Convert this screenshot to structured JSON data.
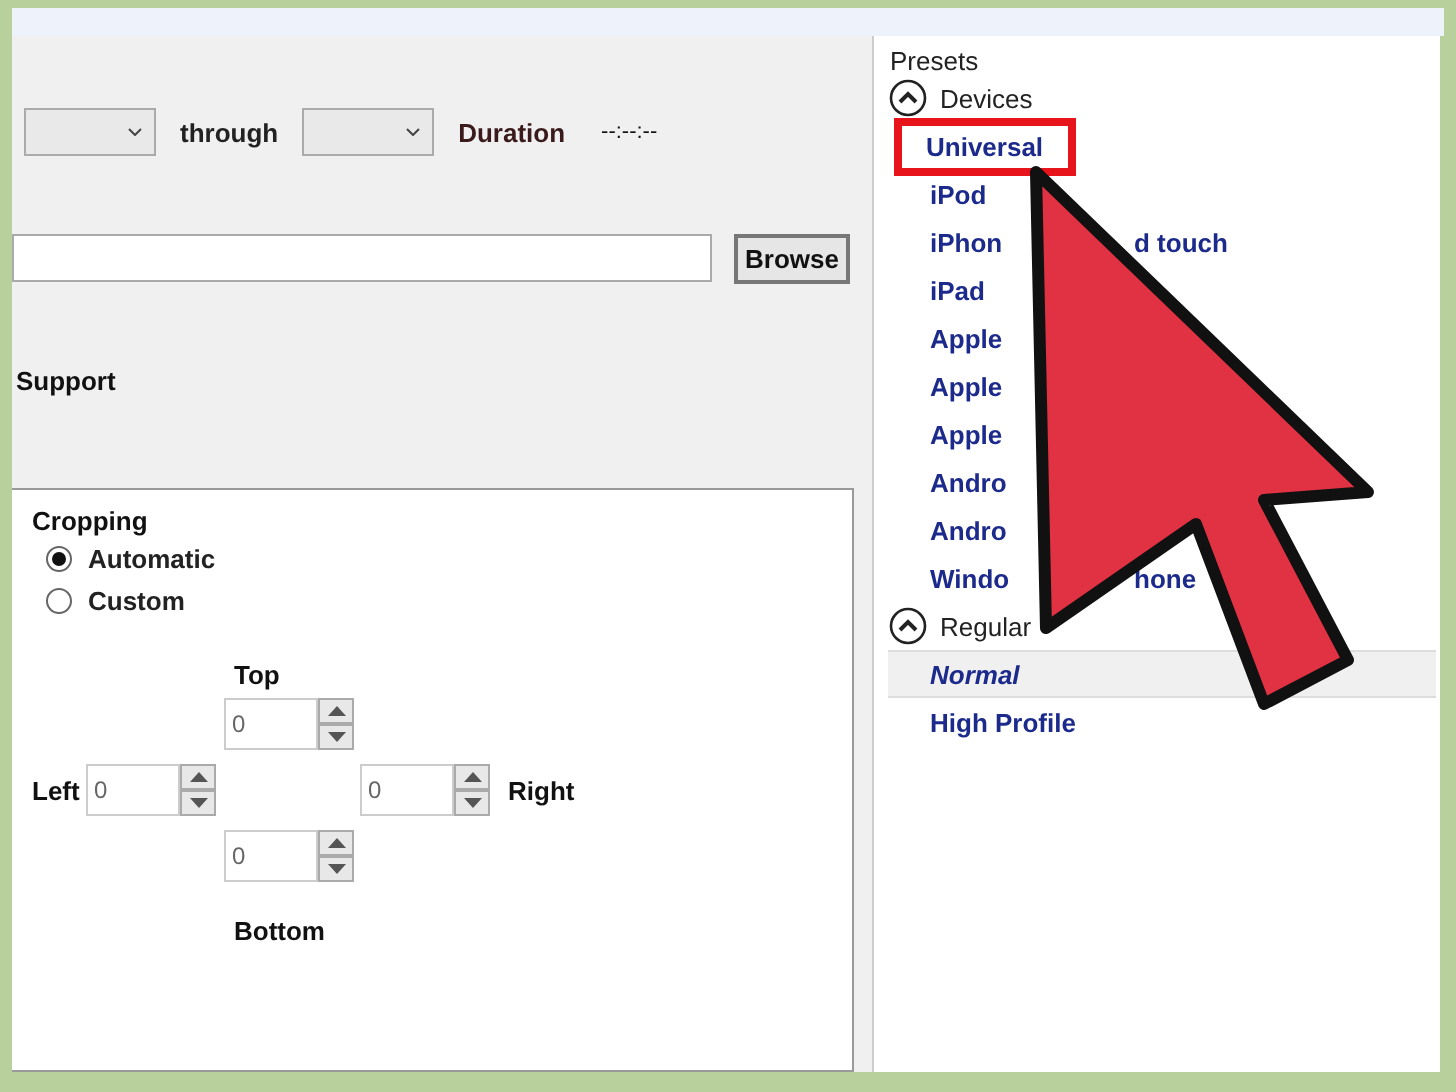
{
  "range": {
    "through_label": "through",
    "duration_label": "Duration",
    "duration": "--:--:--"
  },
  "destination": {
    "browse_button": "Browse"
  },
  "support_label": "Support",
  "cropping": {
    "title": "Cropping",
    "modes": [
      {
        "label": "Automatic",
        "selected": true
      },
      {
        "label": "Custom",
        "selected": false
      }
    ],
    "top": {
      "label": "Top",
      "value": "0"
    },
    "left": {
      "label": "Left",
      "value": "0"
    },
    "right": {
      "label": "Right",
      "value": "0"
    },
    "bottom": {
      "label": "Bottom",
      "value": "0"
    }
  },
  "presets": {
    "title": "Presets",
    "groups": [
      {
        "name": "Devices",
        "expanded": true,
        "items": [
          {
            "label": "Universal",
            "highlighted": true,
            "selected": false,
            "default": false
          },
          {
            "label": "iPod",
            "highlighted": false,
            "selected": false,
            "default": false
          },
          {
            "label": "iPhon",
            "label_after": "d touch",
            "highlighted": false,
            "selected": false,
            "default": false
          },
          {
            "label": "iPad",
            "highlighted": false,
            "selected": false,
            "default": false
          },
          {
            "label": "Apple",
            "highlighted": false,
            "selected": false,
            "default": false
          },
          {
            "label": "Apple",
            "highlighted": false,
            "selected": false,
            "default": false
          },
          {
            "label": "Apple",
            "highlighted": false,
            "selected": false,
            "default": false
          },
          {
            "label": "Andro",
            "highlighted": false,
            "selected": false,
            "default": false
          },
          {
            "label": "Andro",
            "highlighted": false,
            "selected": false,
            "default": false
          },
          {
            "label": "Windo",
            "label_after": "hone",
            "highlighted": false,
            "selected": false,
            "default": false
          }
        ]
      },
      {
        "name": "Regular",
        "expanded": true,
        "items": [
          {
            "label": "Normal",
            "highlighted": false,
            "selected": true,
            "default": true
          },
          {
            "label": "High Profile",
            "highlighted": false,
            "selected": false,
            "default": false
          }
        ]
      }
    ]
  }
}
